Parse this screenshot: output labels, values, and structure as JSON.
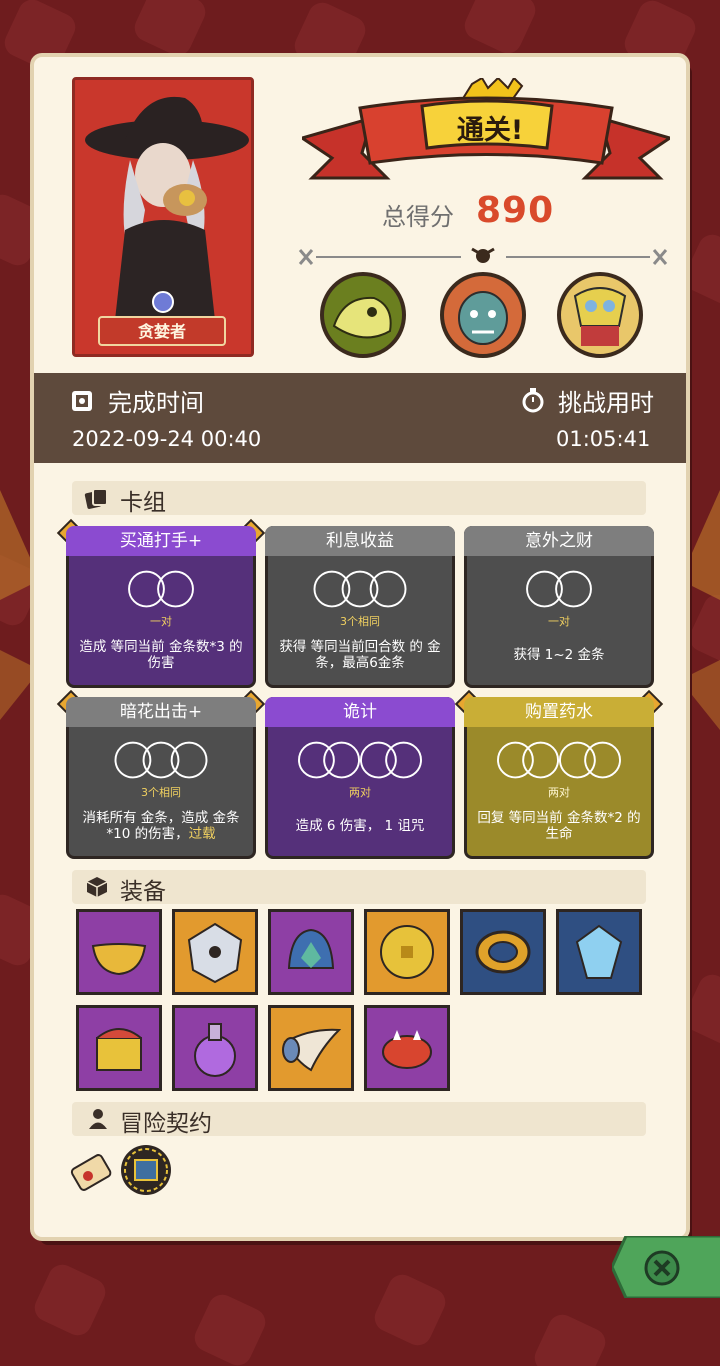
{
  "banner": {
    "title": "通关!"
  },
  "score": {
    "label": "总得分",
    "value": "890"
  },
  "character": {
    "name": "贪婪者"
  },
  "bosses": [
    {
      "icon": "skeleton-dragon-icon"
    },
    {
      "icon": "ogre-icon"
    },
    {
      "icon": "masked-demon-icon"
    }
  ],
  "time": {
    "finish_label": "完成时间",
    "finish_value": "2022-09-24 00:40",
    "challenge_label": "挑战用时",
    "challenge_value": "01:05:41"
  },
  "deck": {
    "title": "卡组",
    "cards": [
      {
        "name": "买通打手+",
        "sub": "一对",
        "desc": "造成 等同当前 金条数*3 的伤害",
        "color": "purple"
      },
      {
        "name": "利息收益",
        "sub": "3个相同",
        "desc": "获得 等同当前回合数 的 金条，最高6金条",
        "color": "gray"
      },
      {
        "name": "意外之财",
        "sub": "一对",
        "desc": "获得  1~2 金条",
        "color": "gray"
      },
      {
        "name": "暗花出击+",
        "sub": "3个相同",
        "desc": "消耗所有 金条，造成 金条*10 的伤害，",
        "desc_extra": "过载",
        "color": "gray"
      },
      {
        "name": "诡计",
        "sub": "两对",
        "desc": "造成 6 伤害， 1 诅咒",
        "color": "purple"
      },
      {
        "name": "购置药水",
        "sub": "两对",
        "desc": "回复 等同当前 金条数*2 的生命",
        "color": "gold"
      }
    ]
  },
  "equipment": {
    "title": "装备",
    "items": [
      {
        "icon": "golden-bowl-icon",
        "bg": "purple"
      },
      {
        "icon": "crystal-dice-icon",
        "bg": "orange"
      },
      {
        "icon": "spiked-helmet-icon",
        "bg": "purple"
      },
      {
        "icon": "gold-coin-icon",
        "bg": "orange"
      },
      {
        "icon": "leopard-ring-icon",
        "bg": "blue"
      },
      {
        "icon": "blue-gem-icon",
        "bg": "blue"
      },
      {
        "icon": "treasure-chest-icon",
        "bg": "purple"
      },
      {
        "icon": "potion-flask-icon",
        "bg": "purple"
      },
      {
        "icon": "cornucopia-horn-icon",
        "bg": "orange"
      },
      {
        "icon": "spiked-bracelet-icon",
        "bg": "purple"
      }
    ]
  },
  "contract": {
    "title": "冒险契约"
  },
  "colors": {
    "accent": "#d94a2b",
    "paper": "#fbf4e4",
    "background": "#6e1c1e"
  }
}
